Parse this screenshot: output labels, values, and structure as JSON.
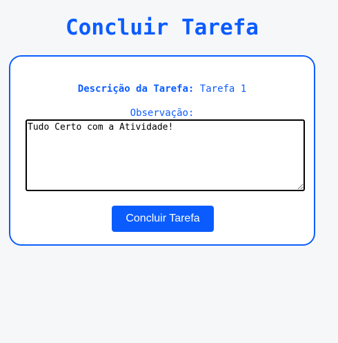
{
  "page": {
    "title": "Concluir Tarefa"
  },
  "form": {
    "description_label": "Descrição da Tarefa:",
    "description_value": "Tarefa 1",
    "observation_label": "Observação:",
    "observation_value": "Tudo Certo com a Atividade!",
    "submit_label": "Concluir Tarefa"
  },
  "colors": {
    "accent": "#0b5cff",
    "background": "#f6f7f9",
    "card": "#ffffff"
  }
}
